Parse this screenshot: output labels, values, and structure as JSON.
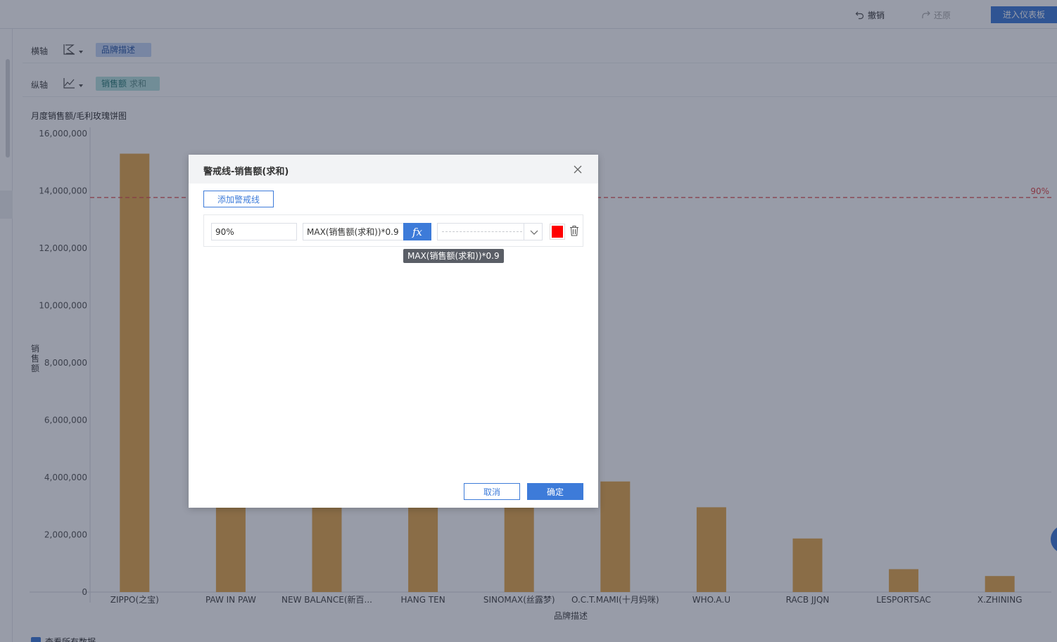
{
  "toolbar": {
    "undo_label": "撤销",
    "redo_label": "还原",
    "enter_dashboard_label": "进入仪表板"
  },
  "x_axis_row": {
    "label": "横轴",
    "field": "品牌描述",
    "icon": "x-axis-icon"
  },
  "y_axis_row": {
    "label": "纵轴",
    "field": "销售额",
    "aggregate": "求和",
    "icon": "line-chart-icon"
  },
  "chart_title": "月度销售额/毛利玫瑰饼图",
  "chart_data": {
    "type": "bar",
    "title": "月度销售额/毛利玫瑰饼图",
    "xlabel": "品牌描述",
    "ylabel": "销售额",
    "ylim": [
      0,
      16000000
    ],
    "ytick_labels": [
      "0",
      "2,000,000",
      "4,000,000",
      "6,000,000",
      "8,000,000",
      "10,000,000",
      "12,000,000",
      "14,000,000",
      "16,000,000"
    ],
    "categories": [
      "ZIPPO(之宝)",
      "PAW IN PAW",
      "NEW BALANCE(新百...",
      "HANG TEN",
      "SINOMAX(丝露梦)",
      "O.C.T.MAMI(十月妈咪)",
      "WHO.A.U",
      "RACB JJQN",
      "LESPORTSAC",
      "X.ZHINING"
    ],
    "values": [
      15300000,
      4900000,
      4700000,
      4400000,
      4100000,
      3860000,
      2960000,
      1870000,
      800000,
      560000
    ],
    "bar_color": "#e6a94c",
    "alert_line": {
      "label": "90%",
      "value": 13770000,
      "color": "#e04b4b"
    },
    "grid": false,
    "legend": "none"
  },
  "dialog": {
    "title": "警戒线-销售额(求和)",
    "add_button_label": "添加警戒线",
    "line": {
      "name": "90%",
      "formula": "MAX(销售额(求和))*0.9",
      "fx_label": "fx",
      "color": "#ff0000"
    },
    "tooltip": "MAX(销售额(求和))*0.9",
    "cancel_label": "取消",
    "ok_label": "确定"
  },
  "bottom": {
    "view_all_label": "查看所有数据"
  }
}
